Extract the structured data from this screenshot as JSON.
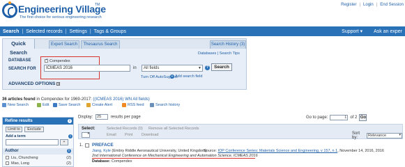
{
  "header": {
    "brand": "Engineering Village",
    "tm": "TM",
    "tagline": "The first choice for serious engineering research",
    "links": [
      "Register",
      "Login",
      "End Session"
    ]
  },
  "nav": {
    "items": [
      "Search",
      "Selected records",
      "Settings",
      "Tags & Groups"
    ],
    "support": "Support ▾",
    "ask": "Ask an exper"
  },
  "search": {
    "tabs": {
      "quick": "Quick Search",
      "expert": "Expert Search",
      "thesaurus": "Thesaurus Search",
      "history": "Search History (3)"
    },
    "db_links": "Databases  |  Search Tips",
    "database_label": "DATABASE",
    "search_for_label": "SEARCH FOR",
    "database_value": "Compendex",
    "query": "ICMEAS 2016",
    "in_label": "in",
    "field": "All fields",
    "search_button": "Search",
    "autosuggest": "Turn Off AutoSuggest",
    "add_field": "Add search field",
    "advanced": "ADVANCED OPTIONS"
  },
  "results": {
    "summary_bold": "36 articles found",
    "summary_rest": " in Compendex for 1969-2017: ",
    "summary_query": "((ICMEAS 2016) WN All fields)",
    "toolbar": [
      "New Search",
      "Edit",
      "Save Search",
      "Create Alert",
      "RSS feed",
      "Search history"
    ],
    "display_label": "Display:",
    "display_value": "25",
    "per_page": "results per page",
    "goto_label": "Go to page:",
    "page_value": "1",
    "of_pages": "of 2",
    "go": "Go",
    "select_label": "Select:",
    "selected_records": "Selected Records (0)",
    "remove_all": "Remove all Selected Records",
    "email": "Email",
    "print": "Print",
    "download": "Download",
    "sort_label": "Sort by:",
    "sort_value": "Relevance"
  },
  "refine": {
    "title": "Refine results",
    "limit": "Limit to",
    "exclude": "Exclude",
    "add_term": "Add a term",
    "add_btn": "+",
    "author_head": "Author",
    "authors": [
      {
        "name": "Liu, Chuncheng",
        "count": "(2)"
      },
      {
        "name": "Mao, Long",
        "count": "(2)"
      }
    ]
  },
  "record": {
    "num": "1.",
    "title": "PREFACE",
    "authors": "Jiang, Kyle",
    "affil": " (Embry Riddle Aeronautical University, United Kingdom)",
    "source_label": "Source: ",
    "source": "IOP Conference Series: Materials Science and Engineering, v 157, n 1",
    "source_rest": ", November 14, 2016, 2016",
    "conference": "2nd International Conference on Mechanical Engineering and Automation Science, ICMEAS 2016",
    "db_label": "Database: ",
    "db_value": "Compendex"
  },
  "colors": {
    "brand_blue": "#1f5fa8",
    "nav_blue": "#2a72b8",
    "highlight_red": "#d9342b"
  }
}
